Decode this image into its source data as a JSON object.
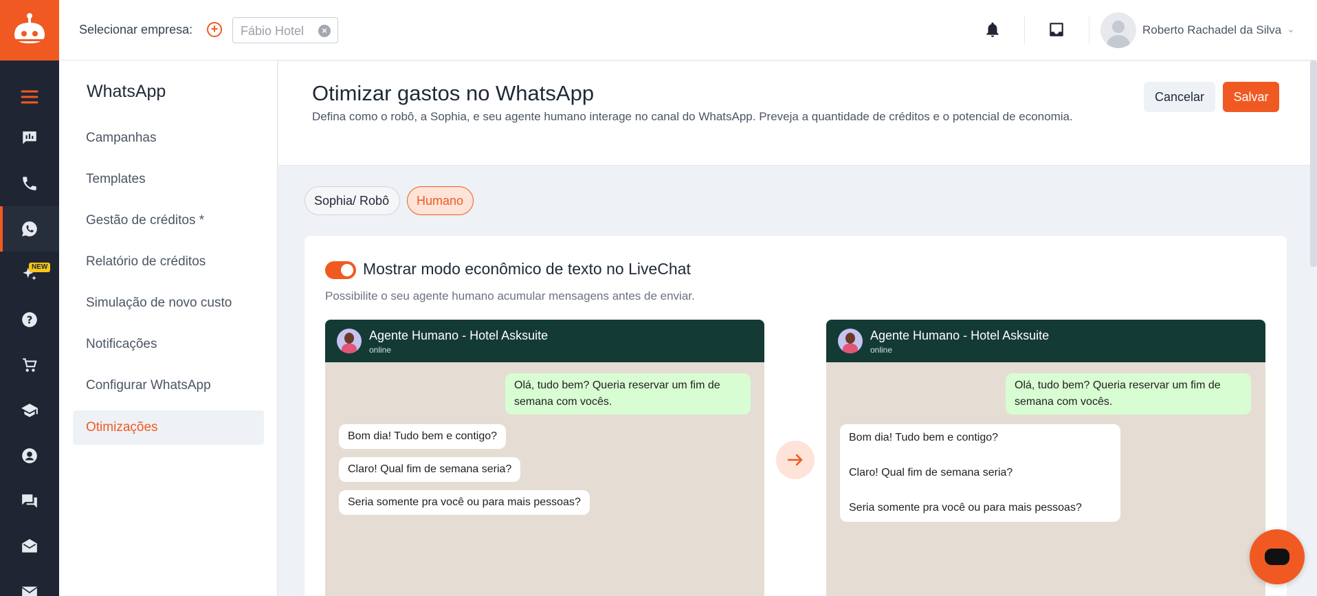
{
  "topbar": {
    "select_label": "Selecionar empresa:",
    "company_value": "Fábio Hotel",
    "user_name": "Roberto Rachadel da Silva"
  },
  "rail": {
    "new_badge": "NEW",
    "icons": [
      "menu-icon",
      "dashboard-chat-icon",
      "phone-icon",
      "whatsapp-icon",
      "sparkle-icon",
      "help-icon",
      "cart-icon",
      "school-icon",
      "account-icon",
      "forum-icon",
      "drafts-icon",
      "mail-icon"
    ]
  },
  "subnav": {
    "title": "WhatsApp",
    "items": [
      {
        "label": "Campanhas"
      },
      {
        "label": "Templates"
      },
      {
        "label": "Gestão de créditos *"
      },
      {
        "label": "Relatório de créditos"
      },
      {
        "label": "Simulação de novo custo"
      },
      {
        "label": "Notificações"
      },
      {
        "label": "Configurar WhatsApp"
      },
      {
        "label": "Otimizações"
      }
    ]
  },
  "main": {
    "title": "Otimizar gastos no WhatsApp",
    "description": "Defina como o robô, a Sophia, e seu agente humano interage no canal do WhatsApp. Preveja a quantidade de créditos e o potencial de economia.",
    "cancel_label": "Cancelar",
    "save_label": "Salvar",
    "tabs": [
      {
        "label": "Sophia/ Robô"
      },
      {
        "label": "Humano"
      }
    ],
    "card": {
      "toggle_on": true,
      "title": "Mostrar modo econômico de texto no LiveChat",
      "description": "Possibilite o seu agente humano acumular mensagens antes de enviar."
    }
  },
  "chat_left": {
    "name": "Agente Humano - Hotel Asksuite",
    "status": "online",
    "out_msg": "Olá, tudo bem? Queria reservar um fim de semana com vocês.",
    "in_msgs": [
      "Bom dia! Tudo bem e contigo?",
      "Claro! Qual fim de semana seria?",
      "Seria somente pra você ou para mais pessoas?"
    ]
  },
  "chat_right": {
    "name": "Agente Humano - Hotel Asksuite",
    "status": "online",
    "out_msg": "Olá, tudo bem? Queria reservar um fim de semana com vocês.",
    "in_lines": [
      "Bom dia! Tudo bem e contigo?",
      "Claro! Qual fim de semana seria?",
      "Seria somente pra você ou para mais pessoas?"
    ]
  },
  "colors": {
    "accent": "#f05a22",
    "rail_bg": "#1f2532",
    "chat_header": "#143a36",
    "chat_bg": "#e5ddd4",
    "bubble_out": "#d8fdd2"
  }
}
